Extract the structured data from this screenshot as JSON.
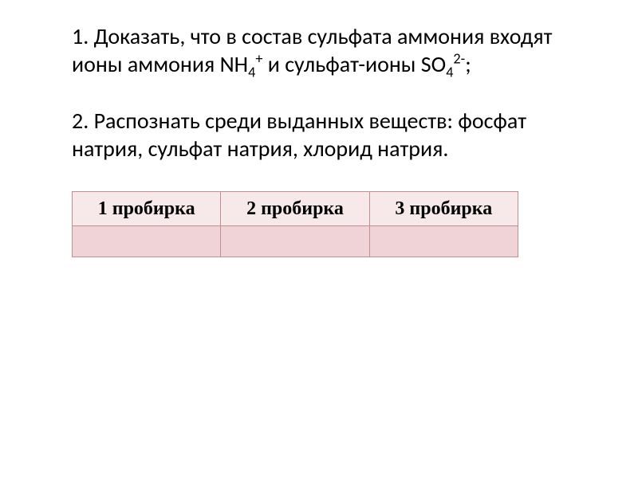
{
  "task1": {
    "prefix": "1. Доказать, что в состав сульфата аммония входят ионы аммония NH",
    "sub1": "4",
    "sup1": "+",
    "middle": " и сульфат-ионы SO",
    "sub2": "4",
    "sup2": "2-",
    "suffix": ";"
  },
  "task2": {
    "text": "2. Распознать среди выданных веществ: фосфат натрия, сульфат натрия, хлорид натрия."
  },
  "table": {
    "headers": [
      "1 пробирка",
      "2 пробирка",
      "3 пробирка"
    ],
    "cells": [
      "",
      "",
      ""
    ]
  }
}
